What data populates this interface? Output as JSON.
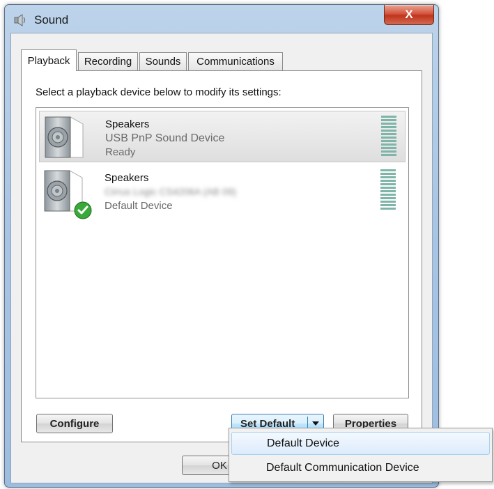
{
  "window": {
    "title": "Sound",
    "close_label": "X"
  },
  "tabs": [
    {
      "label": "Playback",
      "active": true
    },
    {
      "label": "Recording",
      "active": false
    },
    {
      "label": "Sounds",
      "active": false
    },
    {
      "label": "Communications",
      "active": false
    }
  ],
  "playback": {
    "instruction": "Select a playback device below to modify its settings:",
    "devices": [
      {
        "name": "Speakers",
        "description": "USB PnP Sound Device",
        "status": "Ready",
        "selected": true,
        "default": false
      },
      {
        "name": "Speakers",
        "description": "Cirrus Logic CS4206A (AB 09)",
        "status": "Default Device",
        "selected": false,
        "default": true
      }
    ]
  },
  "buttons": {
    "configure": "Configure",
    "set_default": "Set Default",
    "properties": "Properties",
    "ok": "OK"
  },
  "dropdown": {
    "items": [
      {
        "label": "Default Device",
        "hovered": true
      },
      {
        "label": "Default Communication Device",
        "hovered": false
      }
    ]
  },
  "colors": {
    "accent": "#3c7fb1",
    "meter": "#7fb4a8",
    "check": "#3aa83a"
  },
  "icons": {
    "title": "speaker-icon",
    "device": "speaker-icon",
    "default_badge": "check-icon"
  }
}
